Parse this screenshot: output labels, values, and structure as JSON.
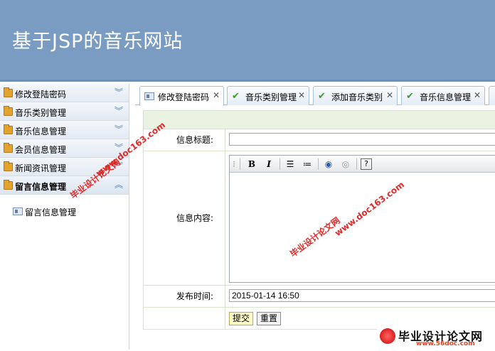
{
  "header": {
    "title": "基于JSP的音乐网站"
  },
  "sidebar": {
    "sections": [
      {
        "label": "修改登陆密码"
      },
      {
        "label": "音乐类别管理"
      },
      {
        "label": "音乐信息管理"
      },
      {
        "label": "会员信息管理"
      },
      {
        "label": "新闻资讯管理"
      },
      {
        "label": "留言信息管理"
      }
    ],
    "sub_item": "留言信息管理"
  },
  "tabs": [
    {
      "label": "修改登陆密码",
      "icon": "card-icon"
    },
    {
      "label": "音乐类别管理",
      "icon": "check-icon"
    },
    {
      "label": "添加音乐类别",
      "icon": "check-icon"
    },
    {
      "label": "音乐信息管理",
      "icon": "check-icon"
    }
  ],
  "form": {
    "title_label": "信息标题:",
    "title_value": "",
    "content_label": "信息内容:",
    "time_label": "发布时间:",
    "time_value": "2015-01-14 16:50",
    "submit_label": "提交",
    "reset_label": "重置"
  },
  "editor_toolbar": {
    "bold": "B",
    "italic": "I",
    "help": "?"
  },
  "watermarks": {
    "url": "www.doc163.com",
    "cn": "毕业设计论文网"
  },
  "logo": {
    "cn": "毕业设计论文网",
    "url": "www.56doc.com"
  },
  "colors": {
    "header_bg": "#7a9cc2",
    "watermark": "#e0201d",
    "form_strip": "#eaf3e2"
  }
}
